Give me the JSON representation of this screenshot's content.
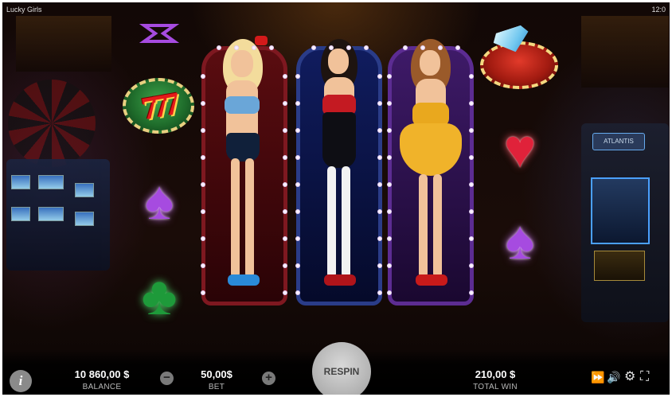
{
  "header": {
    "game_title": "Lucky Girls",
    "clock": "12:0"
  },
  "reels": {
    "left": [
      {
        "symbol": "purple-glyph-icon",
        "label": ""
      },
      {
        "symbol": "seven-chip-icon",
        "label": "777"
      },
      {
        "symbol": "spade-icon",
        "label": "♠"
      },
      {
        "symbol": "club-icon",
        "label": "♣"
      }
    ],
    "right": [
      {
        "symbol": "diamond-chip-icon",
        "label": ""
      },
      {
        "symbol": "heart-icon",
        "label": "♥"
      },
      {
        "symbol": "spade-icon",
        "label": "♠"
      }
    ],
    "center": [
      {
        "symbol": "girl-blonde-wild",
        "panel_color": "#7e1820"
      },
      {
        "symbol": "girl-brunette-wild",
        "panel_color": "#2a3c88"
      },
      {
        "symbol": "girl-redhead-wild",
        "panel_color": "#5c2c92"
      }
    ]
  },
  "decor": {
    "slot_machine_sign": "ATLANTIS"
  },
  "bottom_bar": {
    "info_label": "i",
    "balance_value": "10 860,00 $",
    "balance_caption": "BALANCE",
    "bet_minus": "−",
    "bet_value": "50,00$",
    "bet_caption": "BET",
    "bet_plus": "+",
    "spin_label": "RESPIN",
    "total_win_value": "210,00 $",
    "total_win_caption": "TOTAL WIN",
    "controls": {
      "fast": "⏩",
      "sound": "🔊",
      "settings": "⚙",
      "fullscreen": "⛶"
    }
  },
  "colors": {
    "spade": "#a64be0",
    "club": "#1e9a3a",
    "heart": "#e0223a",
    "spin_button": "#b0b0b0"
  }
}
